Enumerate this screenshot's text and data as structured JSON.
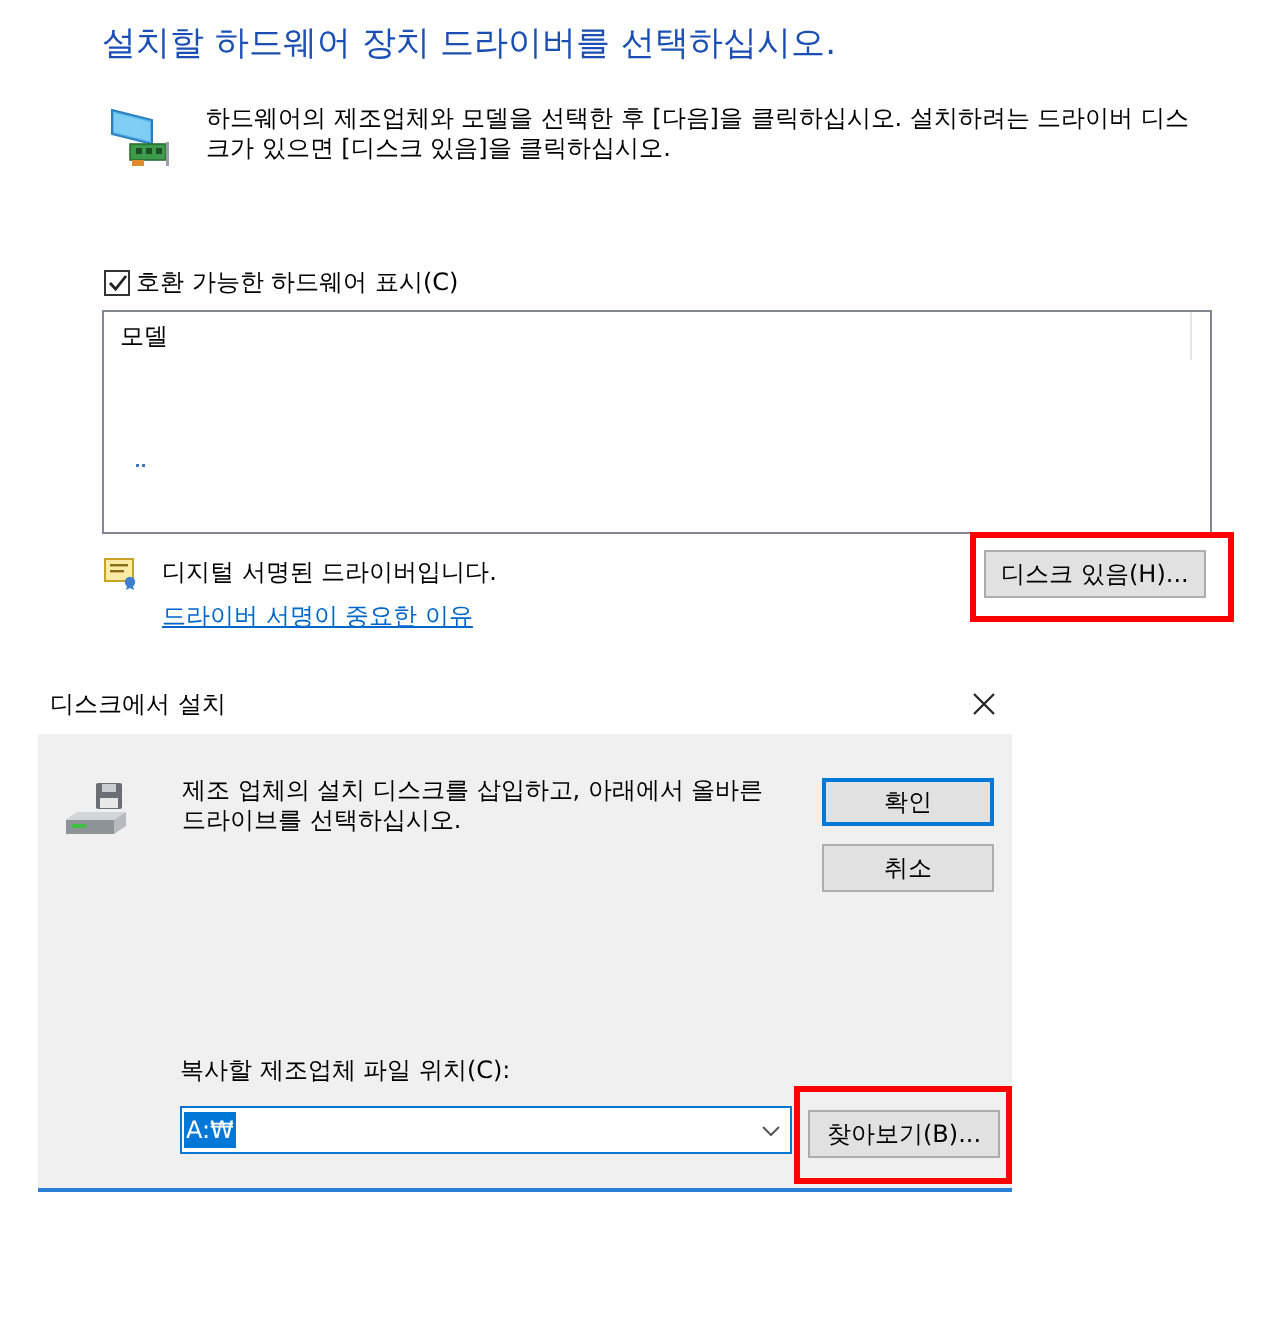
{
  "select_driver": {
    "title": "설치할 하드웨어 장치 드라이버를 선택하십시오.",
    "description": "하드웨어의 제조업체와 모델을 선택한 후 [다음]을 클릭하십시오. 설치하려는 드라이버 디스크가 있으면 [디스크 있음]을 클릭하십시오.",
    "show_compatible": {
      "label": "호환 가능한 하드웨어 표시(C)",
      "checked": true
    },
    "model_list": {
      "column": "모델"
    },
    "signature": {
      "text": "디지털 서명된 드라이버입니다.",
      "link": "드라이버 서명이 중요한 이유"
    },
    "have_disk_button": {
      "label": "디스크 있음(H)...",
      "highlighted": true
    }
  },
  "install_from_disk": {
    "title": "디스크에서 설치",
    "message": "제조 업체의 설치 디스크를 삽입하고, 아래에서 올바른 드라이브를 선택하십시오.",
    "buttons": [
      {
        "label": "확인",
        "default": true
      },
      {
        "label": "취소",
        "default": false
      }
    ],
    "location": {
      "label": "복사할 제조업체 파일 위치(C):",
      "value": "A:₩",
      "focused": true
    },
    "browse_button": {
      "label": "찾아보기(B)...",
      "highlighted": true
    }
  }
}
